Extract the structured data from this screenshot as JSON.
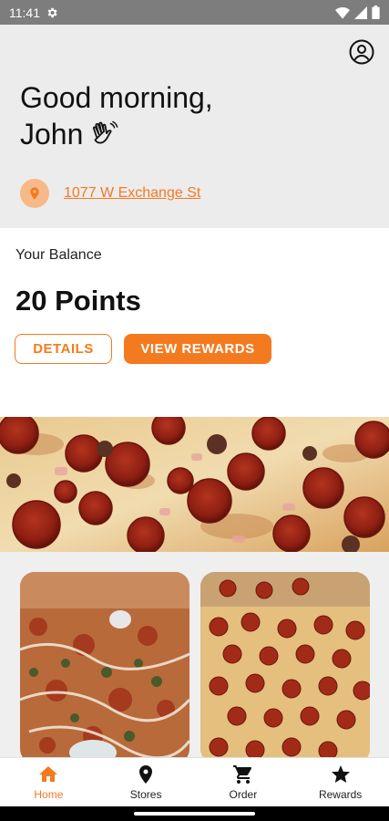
{
  "status_bar": {
    "time": "11:41"
  },
  "header": {
    "greeting_line1": "Good morning,",
    "greeting_name": "John",
    "address": "1077 W Exchange St"
  },
  "balance": {
    "label": "Your Balance",
    "points": "20 Points",
    "details_label": "DETAILS",
    "rewards_label": "VIEW REWARDS"
  },
  "nav": {
    "items": [
      {
        "label": "Home",
        "icon": "home-icon",
        "active": true
      },
      {
        "label": "Stores",
        "icon": "pin-icon",
        "active": false
      },
      {
        "label": "Order",
        "icon": "cart-icon",
        "active": false
      },
      {
        "label": "Rewards",
        "icon": "star-icon",
        "active": false
      }
    ]
  },
  "colors": {
    "accent": "#f47a20",
    "accent_light": "#f8b98a",
    "header_bg": "#ececec"
  }
}
